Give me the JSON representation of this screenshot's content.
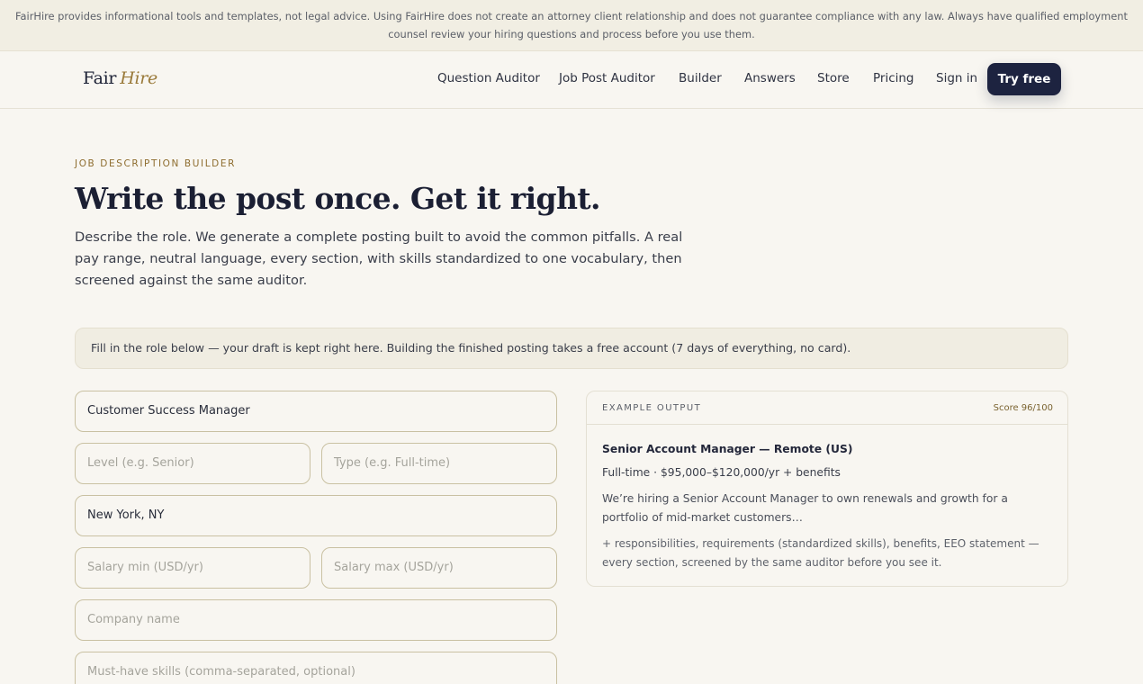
{
  "disclaimer": {
    "text": "FairHire provides informational tools and templates, not legal advice. Using FairHire does not create an attorney client relationship and does not guarantee compliance with any law. Always have qualified employment counsel review your hiring questions and process before you use them."
  },
  "nav": {
    "logo_fair": "Fair",
    "logo_hire": "Hire",
    "links": [
      "Question Auditor",
      "Job Post Auditor",
      "Builder",
      "Answers",
      "Store",
      "Pricing",
      "Sign in"
    ],
    "cta": "Try free"
  },
  "hero": {
    "eyebrow": "JOB DESCRIPTION BUILDER",
    "headline": "Write the post once. Get it right.",
    "lede": "Describe the role. We generate a complete posting built to avoid the common pitfalls. A real pay range, neutral language, every section, with skills standardized to one vocabulary, then screened against the same auditor."
  },
  "notice": {
    "text": "Fill in the role below — your draft is kept right here. Building the finished posting takes a free account (7 days of everything, no card)."
  },
  "form": {
    "job_title": {
      "value": "Customer Success Manager",
      "placeholder": ""
    },
    "level": {
      "value": "",
      "placeholder": "Level (e.g. Senior)"
    },
    "type": {
      "value": "",
      "placeholder": "Type (e.g. Full-time)"
    },
    "location": {
      "value": "New York, NY",
      "placeholder": ""
    },
    "salary_min": {
      "value": "",
      "placeholder": "Salary min (USD/yr)"
    },
    "salary_max": {
      "value": "",
      "placeholder": "Salary max (USD/yr)"
    },
    "company": {
      "value": "",
      "placeholder": "Company name"
    },
    "skills": {
      "value": "",
      "placeholder": "Must-have skills (comma-separated, optional)"
    }
  },
  "example": {
    "label": "EXAMPLE OUTPUT",
    "score": "Score 96/100",
    "title": "Senior Account Manager — Remote (US)",
    "meta": "Full-time · $95,000–$120,000/yr + benefits",
    "body": "We’re hiring a Senior Account Manager to own renewals and growth for a portfolio of mid-market customers…",
    "more": "+ responsibilities, requirements (standardized skills), benefits, EEO statement — every section, screened by the same auditor before you see it."
  },
  "colors": {
    "background": "#f8f6f1",
    "accent_gold": "#9a7a3a",
    "navy": "#1d2340",
    "field_border": "#c9c1a2"
  }
}
